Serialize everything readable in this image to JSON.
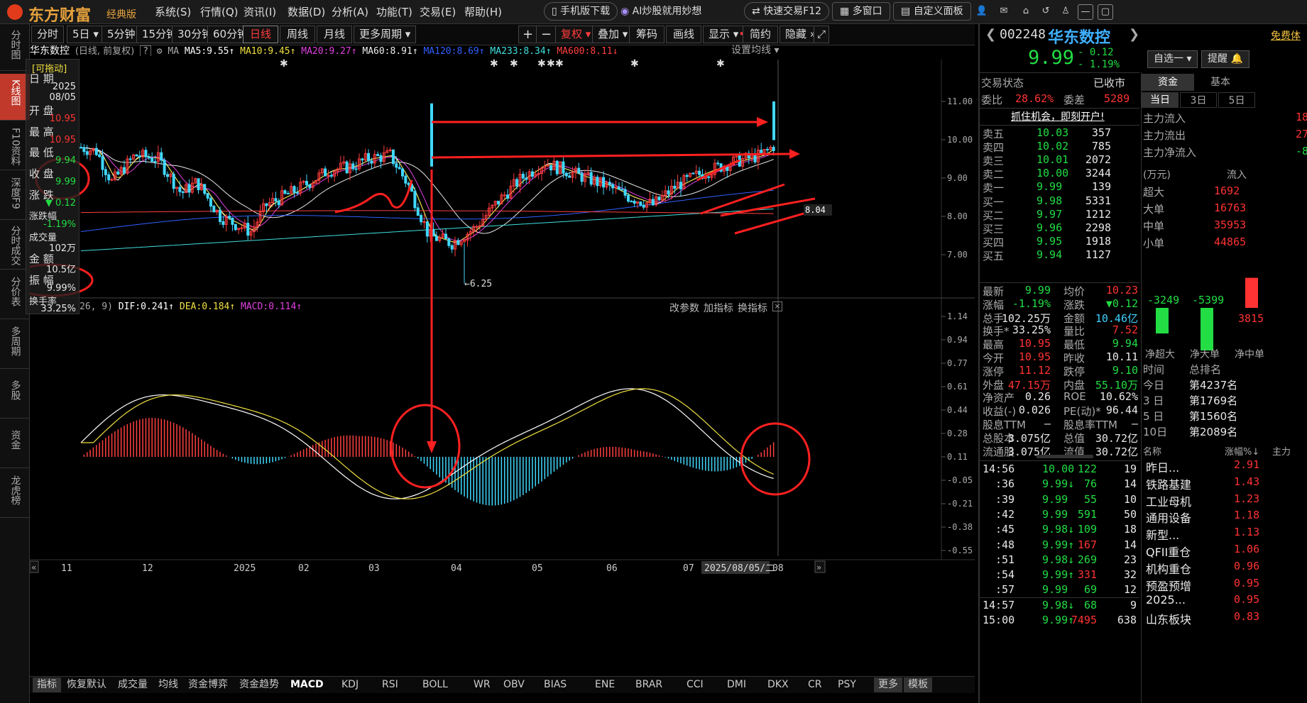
{
  "app": {
    "logo": "东方财富",
    "edition": "经典版"
  },
  "menu": [
    "系统(S)",
    "行情(Q)",
    "资讯(I)",
    "数据(D)",
    "分析(A)",
    "功能(T)",
    "交易(E)",
    "帮助(H)"
  ],
  "top_buttons": {
    "mobile": "手机版下载",
    "ai": "AI炒股就用妙想",
    "quick_trade": "快速交易F12",
    "multi_window": "多窗口",
    "custom_panel": "自定义面板"
  },
  "left_nav": [
    "分时图",
    "K线图",
    "F10资料",
    "深度F9",
    "分时成交",
    "分价表",
    "多周期",
    "多股",
    "资金",
    "龙虎榜"
  ],
  "period_tabs": [
    "分时",
    "5日",
    "5分钟",
    "15分钟",
    "30分钟",
    "60分钟",
    "日线",
    "周线",
    "月线",
    "更多周期"
  ],
  "active_period": "日线",
  "chart_tools": [
    "复权",
    "叠加",
    "筹码",
    "画线",
    "显示",
    "简约",
    "隐藏"
  ],
  "ma_line": {
    "name": "华东数控",
    "mode": "(日线, 前复权)",
    "ma5": "MA5:9.55",
    "ma10": "MA10:9.45",
    "ma20": "MA20:9.27",
    "ma60": "MA60:8.91",
    "ma120": "MA120:8.69",
    "ma233": "MA233:8.34",
    "ma600": "MA600:8.11",
    "settings": "设置均线"
  },
  "info_box": {
    "title": "[可拖动]",
    "date_label": "日 期",
    "date_year": "2025",
    "date_md": "08/05",
    "open_label": "开 盘",
    "open": "10.95",
    "high_label": "最 高",
    "high": "10.95",
    "low_label": "最 低",
    "low": "9.94",
    "close_label": "收 盘",
    "close": "9.99",
    "change_label": "涨 跌",
    "change": "▼ 0.12",
    "pct_label": "涨跌幅",
    "pct": "-1.19%",
    "vol_label": "成交量",
    "vol": "102万",
    "amt_label": "金 额",
    "amt": "10.5亿",
    "amp_label": "振 幅",
    "amp": "9.99%",
    "turn_label": "换手率",
    "turn": "33.25%"
  },
  "price_axis": [
    "11.00",
    "10.00",
    "9.00",
    "8.00",
    "7.00"
  ],
  "price_marker": "8.04",
  "low_label": "←6.25",
  "macd_header": {
    "params": "26, 9)",
    "dif": "DIF:0.241",
    "dea": "DEA:0.184",
    "macd": "MACD:0.114",
    "btn1": "改参数",
    "btn2": "加指标",
    "btn3": "换指标"
  },
  "macd_axis": [
    "1.14",
    "0.94",
    "0.77",
    "0.61",
    "0.44",
    "0.28",
    "0.11",
    "-0.05",
    "-0.21",
    "-0.38",
    "-0.55"
  ],
  "time_axis": [
    "11",
    "12",
    "2025",
    "02",
    "03",
    "04",
    "05",
    "06",
    "07",
    "08"
  ],
  "time_cursor": "2025/08/05/二",
  "indicator_tabs": [
    "指标",
    "恢复默认",
    "成交量",
    "均线",
    "资金博弈",
    "资金趋势",
    "MACD",
    "KDJ",
    "RSI",
    "BOLL",
    "WR",
    "OBV",
    "BIAS",
    "ENE",
    "BRAR",
    "CCI",
    "DMI",
    "DKX",
    "CR",
    "PSY",
    "更多",
    "模板"
  ],
  "stock": {
    "code": "002248",
    "name": "华东数控",
    "price": "9.99",
    "change": "- 0.12",
    "pct": "- 1.19%",
    "watch": "自选一",
    "remind": "提醒",
    "free": "免费体"
  },
  "trade_state": {
    "label": "交易状态",
    "value": "已收市"
  },
  "weibi": {
    "label": "委比",
    "value": "28.62%",
    "diff_label": "委差",
    "diff": "5289"
  },
  "open_account": "抓住机会，即刻开户!",
  "sells": [
    {
      "l": "卖五",
      "p": "10.03",
      "v": "357"
    },
    {
      "l": "卖四",
      "p": "10.02",
      "v": "785"
    },
    {
      "l": "卖三",
      "p": "10.01",
      "v": "2072"
    },
    {
      "l": "卖二",
      "p": "10.00",
      "v": "3244"
    },
    {
      "l": "卖一",
      "p": "9.99",
      "v": "139"
    }
  ],
  "buys": [
    {
      "l": "买一",
      "p": "9.98",
      "v": "5331"
    },
    {
      "l": "买二",
      "p": "9.97",
      "v": "1212"
    },
    {
      "l": "买三",
      "p": "9.96",
      "v": "2298"
    },
    {
      "l": "买四",
      "p": "9.95",
      "v": "1918"
    },
    {
      "l": "买五",
      "p": "9.94",
      "v": "1127"
    }
  ],
  "stats": [
    {
      "l1": "最新",
      "v1": "9.99",
      "l2": "均价",
      "v2": "10.23"
    },
    {
      "l1": "涨幅",
      "v1": "-1.19%",
      "l2": "涨跌",
      "v2": "▼0.12"
    },
    {
      "l1": "总手",
      "v1": "102.25万",
      "l2": "金额",
      "v2": "10.46亿"
    },
    {
      "l1": "换手*",
      "v1": "33.25%",
      "l2": "量比",
      "v2": "7.52"
    },
    {
      "l1": "最高",
      "v1": "10.95",
      "l2": "最低",
      "v2": "9.94"
    },
    {
      "l1": "今开",
      "v1": "10.95",
      "l2": "昨收",
      "v2": "10.11"
    },
    {
      "l1": "涨停",
      "v1": "11.12",
      "l2": "跌停",
      "v2": "9.10"
    },
    {
      "l1": "外盘",
      "v1": "47.15万",
      "l2": "内盘",
      "v2": "55.10万"
    },
    {
      "l1": "净资产",
      "v1": "0.26",
      "l2": "ROE",
      "v2": "10.62%"
    },
    {
      "l1": "收益(-)",
      "v1": "0.026",
      "l2": "PE(动)*",
      "v2": "96.44"
    },
    {
      "l1": "股息TTM",
      "v1": "—",
      "l2": "股息率TTM",
      "v2": "—"
    },
    {
      "l1": "总股本",
      "v1": "3.075亿",
      "l2": "总值",
      "v2": "30.72亿"
    },
    {
      "l1": "流通股",
      "v1": "3.075亿",
      "l2": "流值",
      "v2": "30.72亿"
    }
  ],
  "ticks": [
    {
      "t": "14:56",
      "p": "10.00",
      "v": "122",
      "n": "19",
      "a": ""
    },
    {
      "t": ":36",
      "p": "9.99",
      "v": "76",
      "n": "14",
      "a": "↓"
    },
    {
      "t": ":39",
      "p": "9.99",
      "v": "55",
      "n": "10",
      "a": ""
    },
    {
      "t": ":42",
      "p": "9.99",
      "v": "591",
      "n": "50",
      "a": ""
    },
    {
      "t": ":45",
      "p": "9.98",
      "v": "109",
      "n": "18",
      "a": "↓"
    },
    {
      "t": ":48",
      "p": "9.99",
      "v": "167",
      "n": "14",
      "a": "↑"
    },
    {
      "t": ":51",
      "p": "9.98",
      "v": "269",
      "n": "23",
      "a": "↓"
    },
    {
      "t": ":54",
      "p": "9.99",
      "v": "331",
      "n": "32",
      "a": "↑"
    },
    {
      "t": ":57",
      "p": "9.99",
      "v": "69",
      "n": "12",
      "a": ""
    },
    {
      "t": "14:57",
      "p": "9.98",
      "v": "68",
      "n": "9",
      "a": "↓"
    },
    {
      "t": "15:00",
      "p": "9.99",
      "v": "7495",
      "n": "638",
      "a": "↑"
    }
  ],
  "fund_tabs": [
    "资金",
    "基本"
  ],
  "fund_sub": [
    "当日",
    "3日",
    "5日"
  ],
  "fund_rows": [
    {
      "l": "主力流入",
      "v": "18"
    },
    {
      "l": "主力流出",
      "v": "27"
    },
    {
      "l": "主力净流入",
      "v": "-8"
    }
  ],
  "fund_unit": "(万元)",
  "fund_col": "流入",
  "fund_sizes": [
    {
      "l": "超大",
      "v": "1692"
    },
    {
      "l": "大单",
      "v": "16763"
    },
    {
      "l": "中单",
      "v": "35953"
    },
    {
      "l": "小单",
      "v": "44865"
    }
  ],
  "fund_bars": [
    {
      "label": "净超大",
      "value": "-3249"
    },
    {
      "label": "净大单",
      "value": "-5399"
    },
    {
      "label": "净中单",
      "value": "3815"
    }
  ],
  "rank_header": {
    "c1": "时间",
    "c2": "总排名"
  },
  "ranks": [
    {
      "t": "今日",
      "r": "第4237名"
    },
    {
      "t": "3 日",
      "r": "第1769名"
    },
    {
      "t": "5 日",
      "r": "第1560名"
    },
    {
      "t": "10日",
      "r": "第2089名"
    }
  ],
  "sector_header": {
    "c1": "名称",
    "c2": "涨幅%↓",
    "c3": "主力"
  },
  "sectors": [
    {
      "n": "昨日...",
      "v": "2.91"
    },
    {
      "n": "铁路基建",
      "v": "1.43"
    },
    {
      "n": "工业母机",
      "v": "1.23"
    },
    {
      "n": "通用设备",
      "v": "1.18"
    },
    {
      "n": "新型...",
      "v": "1.13"
    },
    {
      "n": "QFII重仓",
      "v": "1.06"
    },
    {
      "n": "机构重仓",
      "v": "0.96"
    },
    {
      "n": "预盈预增",
      "v": "0.95"
    },
    {
      "n": "2025...",
      "v": "0.95"
    },
    {
      "n": "山东板块",
      "v": "0.83"
    }
  ]
}
